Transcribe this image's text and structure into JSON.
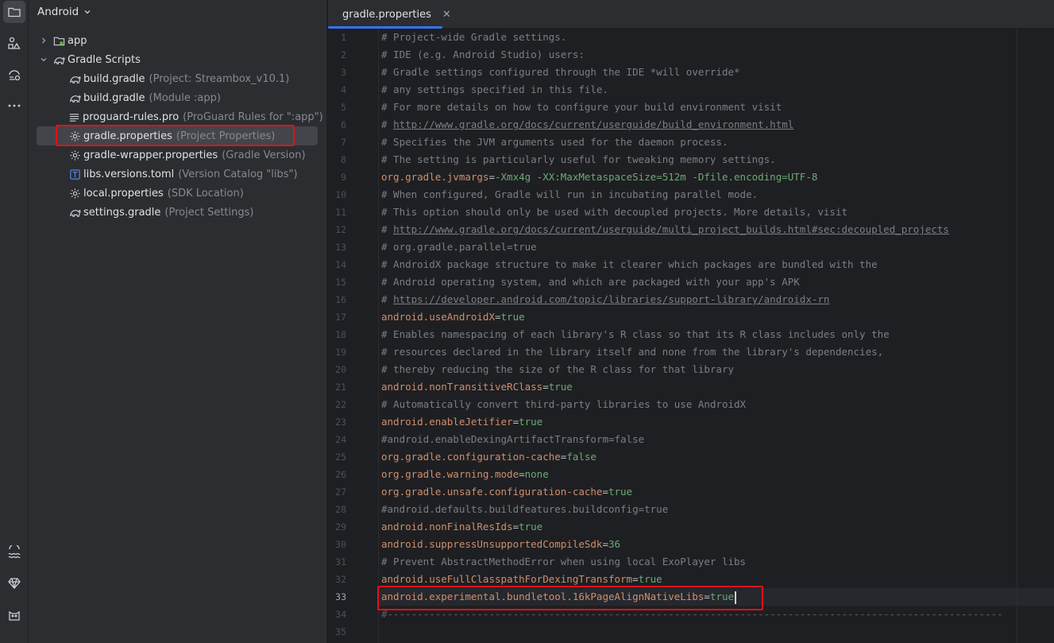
{
  "project_panel": {
    "title": "Android",
    "tree": [
      {
        "name": "app",
        "hint": "",
        "icon": "folder-module-icon",
        "expanded": false
      },
      {
        "name": "Gradle Scripts",
        "hint": "",
        "icon": "gradle-elephant-icon",
        "expanded": true
      },
      {
        "name": "build.gradle",
        "hint": "(Project: Streambox_v10.1)",
        "icon": "gradle-elephant-icon"
      },
      {
        "name": "build.gradle",
        "hint": "(Module :app)",
        "icon": "gradle-elephant-icon"
      },
      {
        "name": "proguard-rules.pro",
        "hint": "(ProGuard Rules for \":app\")",
        "icon": "text-lines-icon"
      },
      {
        "name": "gradle.properties",
        "hint": "(Project Properties)",
        "icon": "gear-icon",
        "selected": true
      },
      {
        "name": "gradle-wrapper.properties",
        "hint": "(Gradle Version)",
        "icon": "gear-icon"
      },
      {
        "name": "libs.versions.toml",
        "hint": "(Version Catalog \"libs\")",
        "icon": "toml-icon"
      },
      {
        "name": "local.properties",
        "hint": "(SDK Location)",
        "icon": "gear-icon"
      },
      {
        "name": "settings.gradle",
        "hint": "(Project Settings)",
        "icon": "gradle-elephant-icon"
      }
    ]
  },
  "editor": {
    "tab_label": "gradle.properties",
    "current_line": 33,
    "lines": [
      {
        "n": "1",
        "type": "comment",
        "text": "# Project-wide Gradle settings."
      },
      {
        "n": "2",
        "type": "comment",
        "text": "# IDE (e.g. Android Studio) users:"
      },
      {
        "n": "3",
        "type": "comment",
        "text": "# Gradle settings configured through the IDE *will override*"
      },
      {
        "n": "4",
        "type": "comment",
        "text": "# any settings specified in this file."
      },
      {
        "n": "5",
        "type": "comment",
        "text": "# For more details on how to configure your build environment visit"
      },
      {
        "n": "6",
        "type": "link",
        "prefix": "# ",
        "text": "http://www.gradle.org/docs/current/userguide/build_environment.html"
      },
      {
        "n": "7",
        "type": "comment",
        "text": "# Specifies the JVM arguments used for the daemon process."
      },
      {
        "n": "8",
        "type": "comment",
        "text": "# The setting is particularly useful for tweaking memory settings."
      },
      {
        "n": "9",
        "type": "prop",
        "key": "org.gradle.jvmargs",
        "value": "-Xmx4g -XX:MaxMetaspaceSize=512m -Dfile.encoding=UTF-8"
      },
      {
        "n": "10",
        "type": "comment",
        "text": "# When configured, Gradle will run in incubating parallel mode."
      },
      {
        "n": "11",
        "type": "comment",
        "text": "# This option should only be used with decoupled projects. More details, visit"
      },
      {
        "n": "12",
        "type": "link",
        "prefix": "# ",
        "text": "http://www.gradle.org/docs/current/userguide/multi_project_builds.html#sec:decoupled_projects"
      },
      {
        "n": "13",
        "type": "comment",
        "text": "# org.gradle.parallel=true"
      },
      {
        "n": "14",
        "type": "comment",
        "text": "# AndroidX package structure to make it clearer which packages are bundled with the"
      },
      {
        "n": "15",
        "type": "comment",
        "text": "# Android operating system, and which are packaged with your app's APK"
      },
      {
        "n": "16",
        "type": "link",
        "prefix": "# ",
        "text": "https://developer.android.com/topic/libraries/support-library/androidx-rn"
      },
      {
        "n": "17",
        "type": "prop",
        "key": "android.useAndroidX",
        "value": "true"
      },
      {
        "n": "18",
        "type": "comment",
        "text": "# Enables namespacing of each library's R class so that its R class includes only the"
      },
      {
        "n": "19",
        "type": "comment",
        "text": "# resources declared in the library itself and none from the library's dependencies,"
      },
      {
        "n": "20",
        "type": "comment",
        "text": "# thereby reducing the size of the R class for that library"
      },
      {
        "n": "21",
        "type": "prop",
        "key": "android.nonTransitiveRClass",
        "value": "true"
      },
      {
        "n": "22",
        "type": "comment",
        "text": "# Automatically convert third-party libraries to use AndroidX"
      },
      {
        "n": "23",
        "type": "prop",
        "key": "android.enableJetifier",
        "value": "true"
      },
      {
        "n": "24",
        "type": "comment",
        "text": "#android.enableDexingArtifactTransform=false"
      },
      {
        "n": "25",
        "type": "prop",
        "key": "org.gradle.configuration-cache",
        "value": "false"
      },
      {
        "n": "26",
        "type": "prop",
        "key": "org.gradle.warning.mode",
        "value": "none"
      },
      {
        "n": "27",
        "type": "prop",
        "key": "org.gradle.unsafe.configuration-cache",
        "value": "true"
      },
      {
        "n": "28",
        "type": "comment",
        "text": "#android.defaults.buildfeatures.buildconfig=true"
      },
      {
        "n": "29",
        "type": "prop",
        "key": "android.nonFinalResIds",
        "value": "true"
      },
      {
        "n": "30",
        "type": "prop",
        "key": "android.suppressUnsupportedCompileSdk",
        "value": "36"
      },
      {
        "n": "31",
        "type": "comment",
        "text": "# Prevent AbstractMethodError when using local ExoPlayer libs"
      },
      {
        "n": "32",
        "type": "prop",
        "key": "android.useFullClasspathForDexingTransform",
        "value": "true"
      },
      {
        "n": "33",
        "type": "prop",
        "key": "android.experimental.bundletool.16kPageAlignNativeLibs",
        "value": "true",
        "caret": true
      },
      {
        "n": "34",
        "type": "dash",
        "text": "#-------------------------------------------------------------------------------------------------------"
      },
      {
        "n": "35",
        "type": "empty",
        "text": ""
      }
    ]
  }
}
